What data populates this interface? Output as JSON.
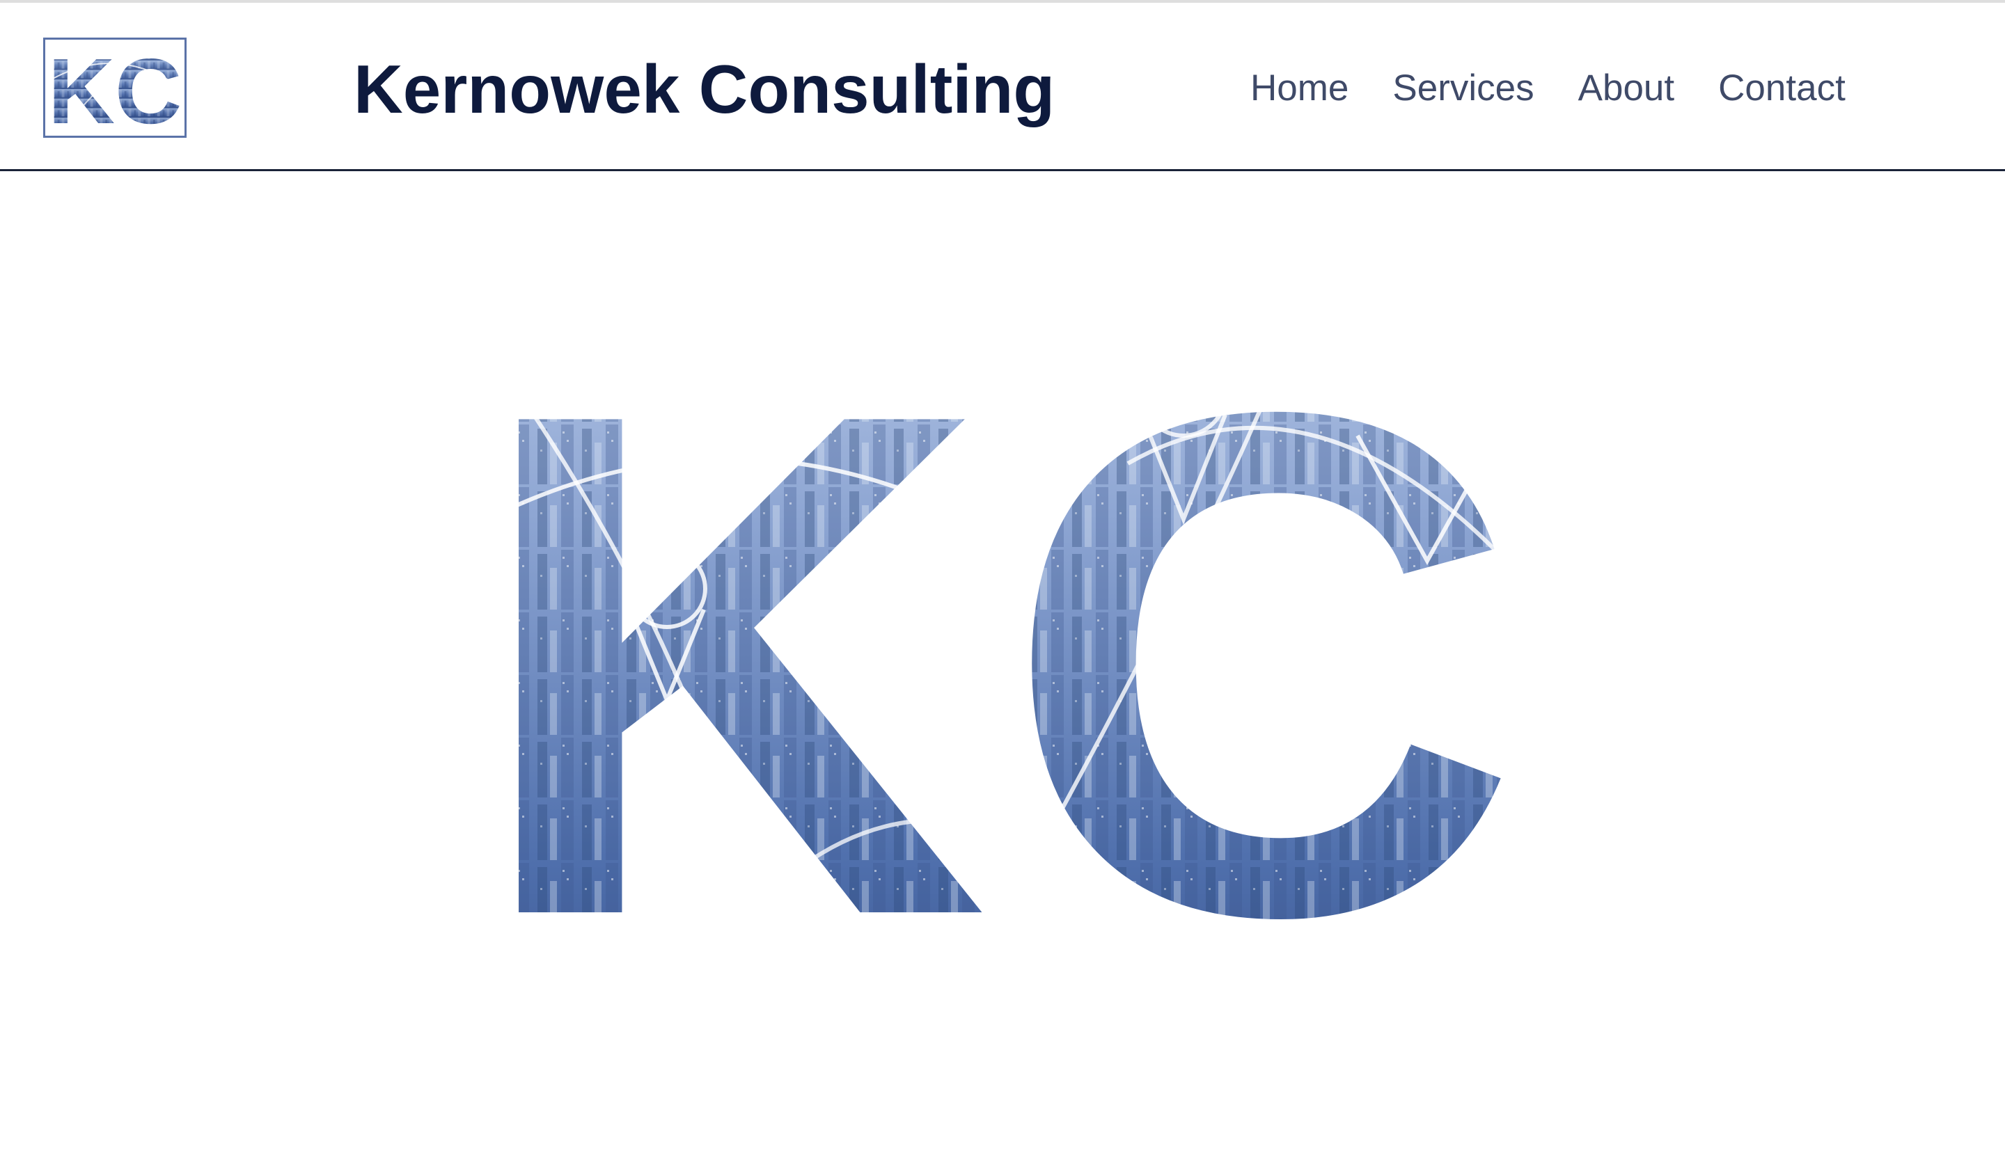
{
  "header": {
    "logo_text": "KC",
    "brand_title": "Kernowek Consulting"
  },
  "nav": {
    "items": [
      {
        "label": "Home"
      },
      {
        "label": "Services"
      },
      {
        "label": "About"
      },
      {
        "label": "Contact"
      }
    ]
  },
  "hero": {
    "monogram": "KC"
  },
  "colors": {
    "brand_navy": "#0e1a3d",
    "nav_text": "#3f4a68",
    "image_blue_dark": "#2c4a85",
    "image_blue_light": "#c7d6ee",
    "header_border": "#1a2238"
  }
}
